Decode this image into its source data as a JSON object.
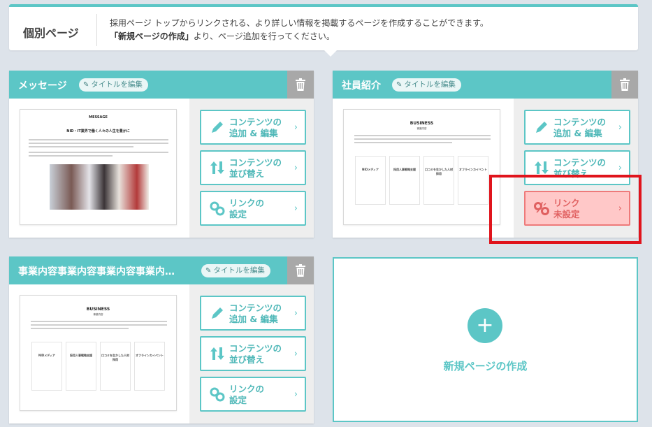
{
  "header": {
    "title": "個別ページ",
    "line1": "採用ページ トップからリンクされる、より詳しい情報を掲載するページを作成することができます。",
    "line2_bold": "「新規ページの作成」",
    "line2_rest": "より、ページ追加を行ってください。"
  },
  "edit_title_label": "タイトルを編集",
  "actions": {
    "contents_line1": "コンテンツの",
    "contents_line2": "追加 & 編集",
    "sort_line1": "コンテンツの",
    "sort_line2": "並び替え",
    "link_line1": "リンクの",
    "link_line2": "設定",
    "link_unset_line1": "リンク",
    "link_unset_line2": "未設定"
  },
  "cards": [
    {
      "title": "メッセージ",
      "thumb": {
        "heading": "MESSAGE",
        "sub": "NID・IT業界で働く人々の人生を豊かに"
      }
    },
    {
      "title": "社員紹介",
      "thumb": {
        "heading": "BUSINESS",
        "sub": "事業内容",
        "boxes": [
          "NIDメディア",
          "採用人事戦略支援",
          "口コミを生かした人材採用",
          "オフラインカイベント"
        ]
      }
    },
    {
      "title": "事業内容事業内容事業内容事業内…",
      "thumb": {
        "heading": "BUSINESS",
        "sub": "事業内容",
        "boxes": [
          "NIDメディア",
          "採用人事戦略支援",
          "口コミを生かした人材採用",
          "オフラインカイベント"
        ]
      }
    }
  ],
  "new_page": {
    "plus": "+",
    "label": "新規ページの作成"
  },
  "colors": {
    "accent": "#5cc6c6",
    "warn_bg": "#ffc8c8",
    "warn_border": "#ee7a7a",
    "highlight": "#e0141c"
  }
}
